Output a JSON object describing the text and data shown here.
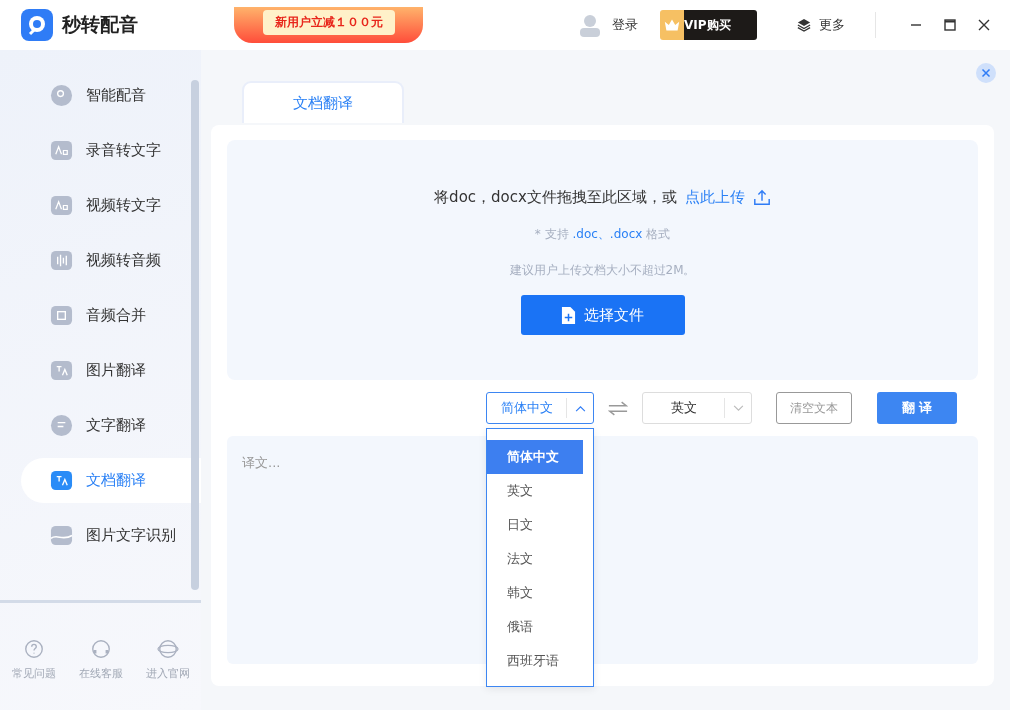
{
  "app": {
    "title": "秒转配音",
    "promo": "新用户立减１００元",
    "login": "登录",
    "vip": "VIP购买",
    "more": "更多"
  },
  "sidebar": {
    "items": [
      {
        "label": "智能配音",
        "kind": "mic",
        "selected": false
      },
      {
        "label": "录音转文字",
        "kind": "aa",
        "selected": false
      },
      {
        "label": "视频转文字",
        "kind": "video",
        "selected": false
      },
      {
        "label": "视频转音频",
        "kind": "wave",
        "selected": false
      },
      {
        "label": "音频合并",
        "kind": "merge",
        "selected": false
      },
      {
        "label": "图片翻译",
        "kind": "imgtr",
        "selected": false
      },
      {
        "label": "文字翻译",
        "kind": "chat",
        "selected": false
      },
      {
        "label": "文档翻译",
        "kind": "doc",
        "selected": true
      },
      {
        "label": "图片文字识别",
        "kind": "ocr",
        "selected": false
      }
    ],
    "footer": [
      {
        "label": "常见问题",
        "kind": "help"
      },
      {
        "label": "在线客服",
        "kind": "service"
      },
      {
        "label": "进入官网",
        "kind": "planet"
      }
    ]
  },
  "tabs": [
    {
      "label": "文档翻译",
      "selected": true
    }
  ],
  "upload": {
    "prompt": "将doc，docx文件拖拽至此区域，或",
    "link": "点此上传",
    "formats_prefix": "* 支持",
    "formats": ".doc、.docx",
    "formats_suffix": "格式",
    "hint": "建议用户上传文档大小不超过2M。",
    "button": "选择文件"
  },
  "source_language": {
    "value": "简体中文",
    "expanded": true,
    "options": [
      {
        "label": "简体中文",
        "selected": true
      },
      {
        "label": "英文",
        "selected": false
      },
      {
        "label": "日文",
        "selected": false
      },
      {
        "label": "法文",
        "selected": false
      },
      {
        "label": "韩文",
        "selected": false
      },
      {
        "label": "俄语",
        "selected": false
      },
      {
        "label": "西班牙语",
        "selected": false
      }
    ]
  },
  "target_language": {
    "value": "英文",
    "expanded": false
  },
  "clear_button": "清空文本",
  "translate_button": "翻 译",
  "output": {
    "placeholder": "译文..."
  }
}
